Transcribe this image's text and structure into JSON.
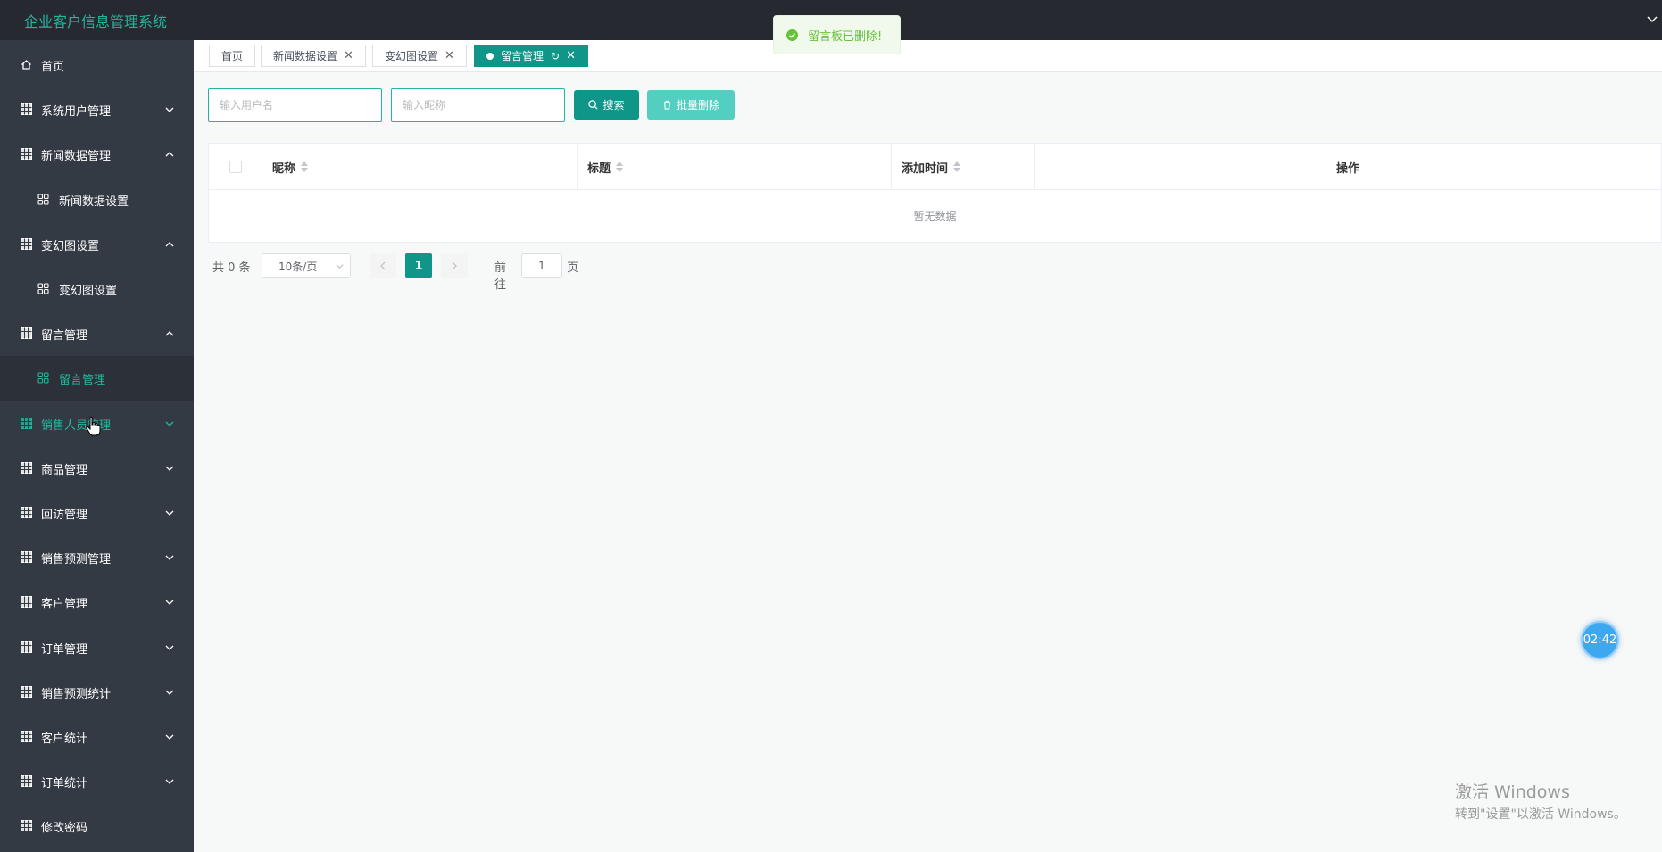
{
  "app": {
    "title": "企业客户信息管理系统"
  },
  "sidebar": {
    "items": [
      {
        "label": "首页",
        "icon": "home-icon",
        "expanded": null
      },
      {
        "label": "系统用户管理",
        "icon": "grid-icon",
        "expanded": false
      },
      {
        "label": "新闻数据管理",
        "icon": "grid-icon",
        "expanded": true
      },
      {
        "label": "新闻数据设置",
        "icon": "apps-icon",
        "sub": true
      },
      {
        "label": "变幻图设置",
        "icon": "grid-icon",
        "expanded": true
      },
      {
        "label": "变幻图设置",
        "icon": "apps-icon",
        "sub": true
      },
      {
        "label": "留言管理",
        "icon": "grid-icon",
        "expanded": true
      },
      {
        "label": "留言管理",
        "icon": "apps-icon",
        "sub": true,
        "active": true
      },
      {
        "label": "销售人员管理",
        "icon": "grid-icon",
        "expanded": false,
        "hover": true
      },
      {
        "label": "商品管理",
        "icon": "grid-icon",
        "expanded": false
      },
      {
        "label": "回访管理",
        "icon": "grid-icon",
        "expanded": false
      },
      {
        "label": "销售预测管理",
        "icon": "grid-icon",
        "expanded": false
      },
      {
        "label": "客户管理",
        "icon": "grid-icon",
        "expanded": false
      },
      {
        "label": "订单管理",
        "icon": "grid-icon",
        "expanded": false
      },
      {
        "label": "销售预测统计",
        "icon": "grid-icon",
        "expanded": false
      },
      {
        "label": "客户统计",
        "icon": "grid-icon",
        "expanded": false
      },
      {
        "label": "订单统计",
        "icon": "grid-icon",
        "expanded": false
      },
      {
        "label": "修改密码",
        "icon": "grid-icon",
        "expanded": null
      }
    ]
  },
  "tabs": [
    {
      "label": "首页",
      "closable": false
    },
    {
      "label": "新闻数据设置",
      "closable": true
    },
    {
      "label": "变幻图设置",
      "closable": true
    },
    {
      "label": "留言管理",
      "closable": true,
      "active": true
    }
  ],
  "tab_close_glyph": "✕",
  "tab_refresh_glyph": "↻",
  "search": {
    "username_placeholder": "输入用户名",
    "nickname_placeholder": "输入昵称",
    "search_label": "搜索",
    "batch_delete_label": "批量删除"
  },
  "table": {
    "columns": [
      "昵称",
      "标题",
      "添加时间",
      "操作"
    ],
    "empty_text": "暂无数据"
  },
  "pagination": {
    "total": "共 0 条",
    "page_size": "10条/页",
    "current_page": "1",
    "goto_label": "前往",
    "goto_value": "1",
    "page_word": "页"
  },
  "toast": {
    "message": "留言板已删除!"
  },
  "timer": {
    "text": "02:42"
  },
  "watermark": {
    "line1": "激活 Windows",
    "line2": "转到\"设置\"以激活 Windows。"
  },
  "colors": {
    "accent": "#0f9688",
    "sidebar_bg": "#343a44",
    "topbar_bg": "#262930",
    "highlight": "#25b59c"
  }
}
